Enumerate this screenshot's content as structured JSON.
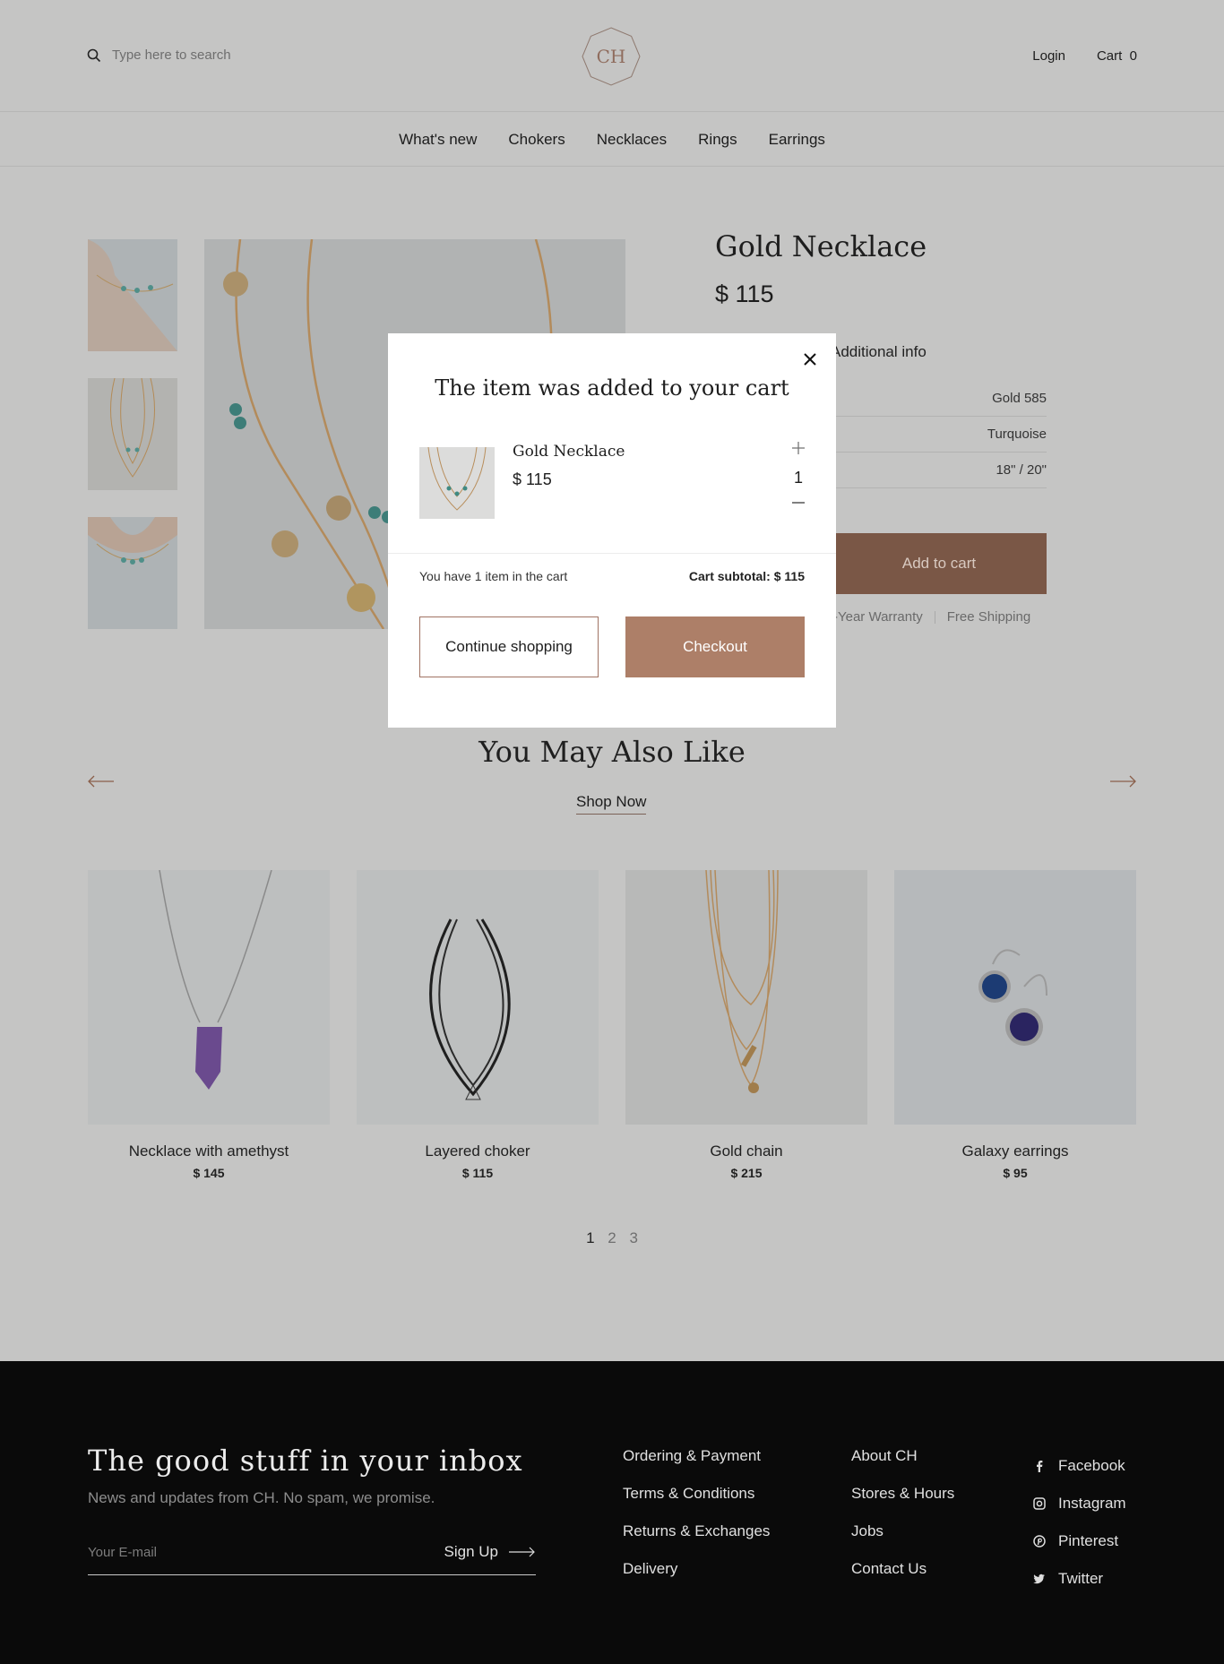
{
  "header": {
    "search_placeholder": "Type here to search",
    "logo": "CH",
    "login": "Login",
    "cart_label": "Cart",
    "cart_count": "0"
  },
  "nav": [
    "What's new",
    "Chokers",
    "Necklaces",
    "Rings",
    "Earrings"
  ],
  "product": {
    "title": "Gold Necklace",
    "price": "$ 115",
    "info_tab": "Additional info",
    "specs": [
      "Gold 585",
      "Turquoise",
      "18\" / 20\""
    ],
    "add_to_cart": "Add to cart",
    "perks": [
      "-Year Warranty",
      "Free Shipping"
    ]
  },
  "also_like": {
    "title": "You May Also Like",
    "shop_now": "Shop Now",
    "items": [
      {
        "name": "Necklace with amethyst",
        "price": "$ 145"
      },
      {
        "name": "Layered choker",
        "price": "$ 115"
      },
      {
        "name": "Gold chain",
        "price": "$ 215"
      },
      {
        "name": "Galaxy earrings",
        "price": "$ 95"
      }
    ],
    "pages": [
      "1",
      "2",
      "3"
    ]
  },
  "modal": {
    "title": "The item was added to your cart",
    "item_name": "Gold Necklace",
    "item_price": "$ 115",
    "quantity": "1",
    "count_text": "You have 1 item in the cart",
    "subtotal_text": "Cart subtotal: $ 115",
    "continue": "Continue shopping",
    "checkout": "Checkout"
  },
  "footer": {
    "title": "The good stuff in your inbox",
    "subtitle": "News and updates from CH. No spam, we promise.",
    "email_placeholder": "Your E-mail",
    "signup": "Sign Up",
    "col1": [
      "Ordering & Payment",
      "Terms & Conditions",
      "Returns & Exchanges",
      "Delivery"
    ],
    "col2": [
      "About CH",
      "Stores & Hours",
      "Jobs",
      "Contact Us"
    ],
    "social": [
      {
        "label": "Facebook",
        "icon": "facebook-icon"
      },
      {
        "label": "Instagram",
        "icon": "instagram-icon"
      },
      {
        "label": "Pinterest",
        "icon": "pinterest-icon"
      },
      {
        "label": "Twitter",
        "icon": "twitter-icon"
      }
    ]
  },
  "colors": {
    "overlay_bg": "#c5c5c4",
    "accent": "#ad7f68",
    "footer_bg": "#0a0a0a"
  }
}
